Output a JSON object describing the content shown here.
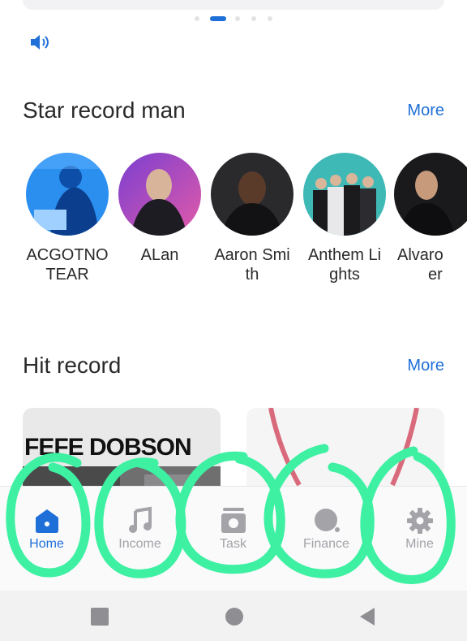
{
  "carousel": {
    "pages": 5,
    "active_index": 1
  },
  "sections": {
    "star": {
      "title": "Star record man",
      "more": "More"
    },
    "hit": {
      "title": "Hit record",
      "more": "More"
    }
  },
  "artists": [
    {
      "line1": "ACGOTNO",
      "line2": "TEAR"
    },
    {
      "line1": "ALan",
      "line2": ""
    },
    {
      "line1": "Aaron Smi",
      "line2": "th"
    },
    {
      "line1": "Anthem Li",
      "line2": "ghts"
    },
    {
      "line1": "Alvaro",
      "line2": "er"
    }
  ],
  "hit_records": [
    {
      "cover_text": "FEFE DOBSON"
    },
    {
      "cover_text": ""
    }
  ],
  "nav": [
    {
      "label": "Home",
      "icon": "home-icon",
      "active": true
    },
    {
      "label": "Income",
      "icon": "music-note-icon",
      "active": false
    },
    {
      "label": "Task",
      "icon": "task-icon",
      "active": false
    },
    {
      "label": "Finance",
      "icon": "finance-icon",
      "active": false
    },
    {
      "label": "Mine",
      "icon": "gear-icon",
      "active": false
    }
  ],
  "system_nav": [
    "recent-apps",
    "home",
    "back"
  ],
  "colors": {
    "accent": "#1f6fd8",
    "inactive": "#a3a3a8",
    "annotation": "#3df0a2"
  }
}
